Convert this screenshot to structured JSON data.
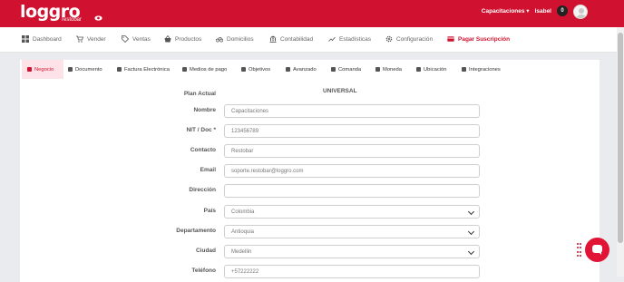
{
  "app": {
    "logo_text": "loggro",
    "logo_sub": "restobar",
    "account_menu": "Capacitaciones ▾",
    "user_name": "Isabel",
    "notification_count": "0",
    "brand_color": "#d0112f"
  },
  "mainnav": [
    {
      "label": "Dashboard",
      "icon": "dashboard-icon"
    },
    {
      "label": "Vender",
      "icon": "cart-icon"
    },
    {
      "label": "Ventas",
      "icon": "tag-icon"
    },
    {
      "label": "Productos",
      "icon": "basket-icon"
    },
    {
      "label": "Domicilios",
      "icon": "bicycle-icon"
    },
    {
      "label": "Contabilidad",
      "icon": "bank-icon"
    },
    {
      "label": "Estadísticas",
      "icon": "chart-line-icon"
    },
    {
      "label": "Configuración",
      "icon": "gear-icon"
    },
    {
      "label": "Pagar Suscripción",
      "icon": "credit-card-icon"
    }
  ],
  "subtabs": [
    {
      "label": "Negocio",
      "active": true
    },
    {
      "label": "Documento"
    },
    {
      "label": "Factura Electrónica"
    },
    {
      "label": "Medios de pago"
    },
    {
      "label": "Objetivos"
    },
    {
      "label": "Avanzado"
    },
    {
      "label": "Comanda"
    },
    {
      "label": "Moneda"
    },
    {
      "label": "Ubicación"
    },
    {
      "label": "Integraciones"
    }
  ],
  "form": {
    "plan_label": "Plan Actual",
    "plan_value": "UNIVERSAL",
    "fields": [
      {
        "label": "Nombre",
        "value": "Capacitaciones"
      },
      {
        "label": "NIT / Doc *",
        "value": "123456789"
      },
      {
        "label": "Contacto",
        "value": "Restobar"
      },
      {
        "label": "Email",
        "value": "soporte.restobar@loggro.com"
      },
      {
        "label": "Dirección",
        "value": ""
      },
      {
        "label": "País",
        "value": "Colombia"
      },
      {
        "label": "Departamento",
        "value": "Antioquia"
      },
      {
        "label": "Ciudad",
        "value": "Medellin"
      },
      {
        "label": "Teléfono",
        "value": "+57222222"
      }
    ]
  }
}
